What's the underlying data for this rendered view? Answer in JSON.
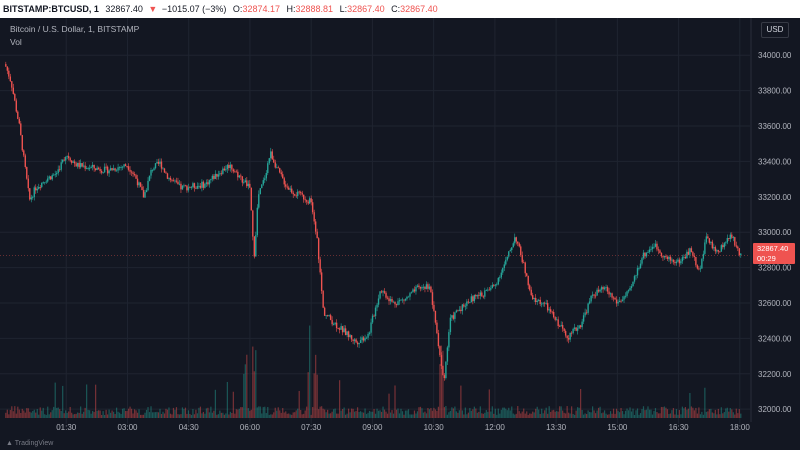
{
  "header": {
    "symbol": "BITSTAMP:BTCUSD, 1",
    "last": "32867.40",
    "change_arrow": "▼",
    "change": "−1015.07 (−3%)",
    "open_label": "O:",
    "open": "32874.17",
    "high_label": "H:",
    "high": "32888.81",
    "low_label": "L:",
    "low": "32867.40",
    "close_label": "C:",
    "close": "32867.40"
  },
  "legend": {
    "title": "Bitcoin / U.S. Dollar, 1, BITSTAMP",
    "vol_label": "Vol"
  },
  "currency_button": "USD",
  "price_tag": {
    "price": "32867.40",
    "countdown": "00:29"
  },
  "footer": {
    "brand": "TradingView"
  },
  "colors": {
    "background": "#131722",
    "up": "#26a69a",
    "down": "#ef5350",
    "grid": "#1f2430",
    "axis_text": "#b2b5be"
  },
  "chart_data": {
    "type": "candlestick",
    "title": "Bitcoin / U.S. Dollar, 1, BITSTAMP",
    "y_axis": {
      "range": [
        31950,
        34120
      ],
      "ticks": [
        34000,
        33800,
        33600,
        33400,
        33200,
        33000,
        32800,
        32600,
        32400,
        32200,
        32000
      ],
      "tick_labels": [
        "34000.00",
        "33800.00",
        "33600.00",
        "33400.00",
        "33200.00",
        "33000.00",
        "32800.00",
        "32600.00",
        "32400.00",
        "32200.00",
        "32000.00"
      ]
    },
    "x_axis": {
      "range_hours": [
        0,
        18.2
      ],
      "ticks_hours": [
        1.5,
        3,
        4.5,
        6,
        7.5,
        9,
        10.5,
        12,
        13.5,
        15,
        16.5,
        18
      ],
      "tick_labels": [
        "01:30",
        "03:00",
        "04:30",
        "06:00",
        "07:30",
        "09:00",
        "10:30",
        "12:00",
        "13:30",
        "15:00",
        "16:30",
        "18:00"
      ]
    },
    "last_price": 32867.4,
    "grid": true,
    "price_path": {
      "times_hours": [
        0,
        0.15,
        0.35,
        0.5,
        0.6,
        0.75,
        1.0,
        1.25,
        1.5,
        1.75,
        2.0,
        2.5,
        3.0,
        3.2,
        3.4,
        3.6,
        3.8,
        4.0,
        4.3,
        4.6,
        4.9,
        5.2,
        5.5,
        5.8,
        6.0,
        6.1,
        6.2,
        6.35,
        6.5,
        6.7,
        6.9,
        7.1,
        7.3,
        7.5,
        7.65,
        7.8,
        8.0,
        8.3,
        8.6,
        8.9,
        9.2,
        9.5,
        9.8,
        10.1,
        10.4,
        10.6,
        10.75,
        10.9,
        11.1,
        11.4,
        11.7,
        12.0,
        12.3,
        12.5,
        12.7,
        12.9,
        13.2,
        13.5,
        13.8,
        14.1,
        14.4,
        14.7,
        15.0,
        15.3,
        15.6,
        15.9,
        16.2,
        16.5,
        16.8,
        17.0,
        17.2,
        17.4,
        17.6,
        17.8,
        18.0
      ],
      "prices": [
        33950,
        33850,
        33600,
        33350,
        33180,
        33250,
        33300,
        33330,
        33440,
        33380,
        33370,
        33350,
        33380,
        33310,
        33200,
        33360,
        33390,
        33310,
        33250,
        33260,
        33270,
        33330,
        33380,
        33300,
        33250,
        32850,
        33200,
        33300,
        33450,
        33340,
        33260,
        33220,
        33200,
        33170,
        32950,
        32550,
        32500,
        32440,
        32380,
        32420,
        32680,
        32600,
        32620,
        32680,
        32700,
        32400,
        32150,
        32500,
        32560,
        32620,
        32650,
        32700,
        32850,
        32980,
        32820,
        32620,
        32600,
        32500,
        32410,
        32480,
        32650,
        32680,
        32600,
        32660,
        32860,
        32930,
        32850,
        32830,
        32900,
        32780,
        32980,
        32880,
        32930,
        32980,
        32870
      ]
    },
    "volume_spikes_hours": [
      5.9,
      6.1,
      7.45,
      7.6,
      10.7
    ]
  }
}
